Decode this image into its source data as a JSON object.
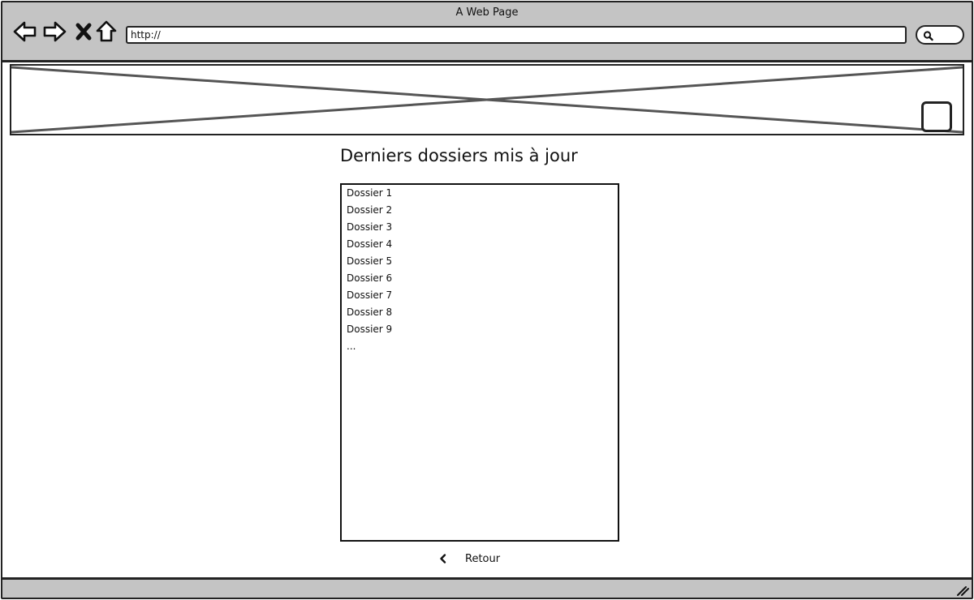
{
  "window": {
    "title": "A Web Page"
  },
  "toolbar": {
    "icons": [
      "back-arrow-icon",
      "forward-arrow-icon",
      "close-icon",
      "home-icon",
      "search-icon"
    ],
    "url": "http://"
  },
  "banner": {
    "placeholder": "image-placeholder"
  },
  "main": {
    "title": "Derniers dossiers mis à jour",
    "folders": [
      "Dossier 1",
      "Dossier 2",
      "Dossier 3",
      "Dossier 4",
      "Dossier 5",
      "Dossier 6",
      "Dossier 7",
      "Dossier 8",
      "Dossier 9",
      "..."
    ],
    "back_label": "Retour"
  },
  "colors": {
    "chrome": "#c4c4c4",
    "outline": "#222222"
  }
}
